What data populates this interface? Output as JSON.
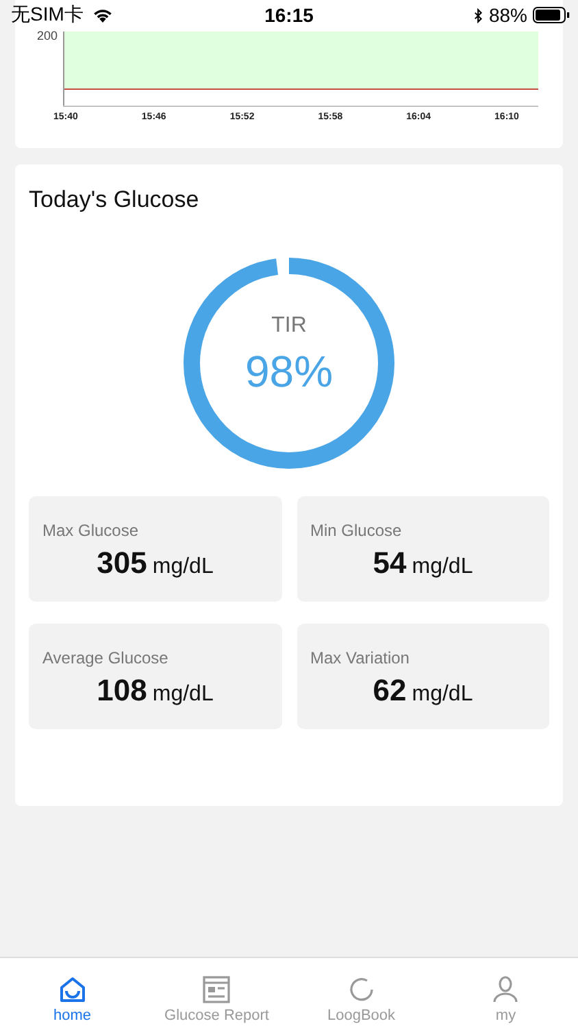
{
  "status_bar": {
    "carrier": "无SIM卡",
    "time": "16:15",
    "battery": "88%"
  },
  "trend_chart": {
    "y_label": "200",
    "x_labels": [
      "15:40",
      "15:46",
      "15:52",
      "15:58",
      "16:04",
      "16:10"
    ]
  },
  "todays_glucose": {
    "title": "Today's Glucose",
    "tir": {
      "label": "TIR",
      "value": "98%",
      "level": 0.98
    },
    "stats": [
      {
        "label": "Max Glucose",
        "value": "305",
        "unit": "mg/dL"
      },
      {
        "label": "Min Glucose",
        "value": "54",
        "unit": "mg/dL"
      },
      {
        "label": "Average Glucose",
        "value": "108",
        "unit": "mg/dL"
      },
      {
        "label": "Max Variation",
        "value": "62",
        "unit": "mg/dL"
      }
    ]
  },
  "tab_bar": [
    {
      "label": "home",
      "kind": "home",
      "selected": true
    },
    {
      "label": "Glucose Report",
      "kind": "report",
      "selected": false
    },
    {
      "label": "LoogBook",
      "kind": "log",
      "selected": false
    },
    {
      "label": "my",
      "kind": "person",
      "selected": false
    }
  ]
}
